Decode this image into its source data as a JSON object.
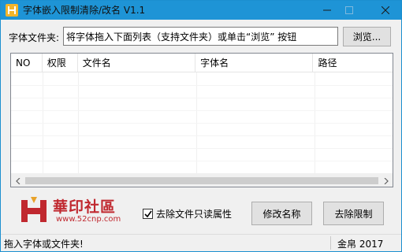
{
  "window": {
    "title": "字体嵌入限制清除/改名 V1.1",
    "accent_color": "#1e94d6",
    "icon": "app-logo-icon"
  },
  "folder": {
    "label": "字体文件夹:",
    "input_value": "将字体拖入下面列表（支持文件夹）或单击“浏览” 按钮",
    "browse_label": "浏览..."
  },
  "list": {
    "columns": [
      "NO",
      "权限",
      "文件名",
      "字体名",
      "路径"
    ],
    "rows": []
  },
  "logo": {
    "text": "華印社區",
    "url": "www.52cnp.com"
  },
  "options": {
    "readonly_checkbox_label": "去除文件只读属性",
    "readonly_checked": true
  },
  "actions": {
    "rename_label": "修改名称",
    "remove_label": "去除限制"
  },
  "status": {
    "left_text": "拖入字体或文件夹!",
    "right_text": "金帛 2017"
  }
}
